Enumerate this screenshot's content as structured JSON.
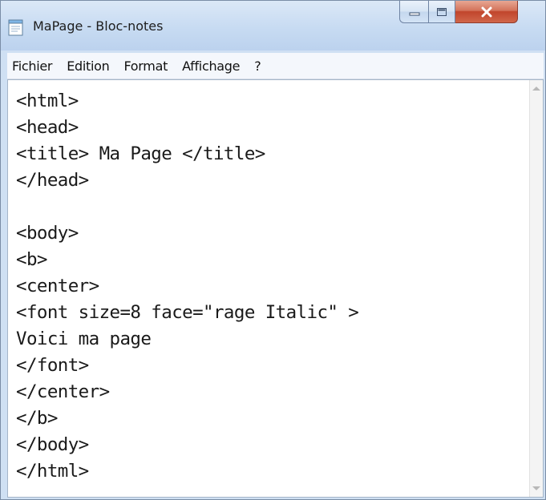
{
  "window": {
    "title": "MaPage - Bloc-notes",
    "app_icon": "notepad-icon",
    "controls": {
      "minimize_icon": "minimize-icon",
      "maximize_icon": "maximize-icon",
      "close_icon": "close-icon"
    }
  },
  "menu": {
    "items": [
      {
        "label": "Fichier"
      },
      {
        "label": "Edition"
      },
      {
        "label": "Format"
      },
      {
        "label": "Affichage"
      },
      {
        "label": "?"
      }
    ]
  },
  "editor": {
    "lines": [
      "<html>",
      "<head>",
      "<title> Ma Page </title>",
      "</head>",
      "",
      "<body>",
      "<b>",
      "<center>",
      "<font size=8 face=\"rage Italic\" >",
      "Voici ma page",
      "</font>",
      "</center>",
      "</b>",
      "</body>",
      "</html>"
    ]
  },
  "colors": {
    "titlebar": "#c7dbf2",
    "close_button": "#c1452c",
    "editor_background": "#ffffff"
  }
}
